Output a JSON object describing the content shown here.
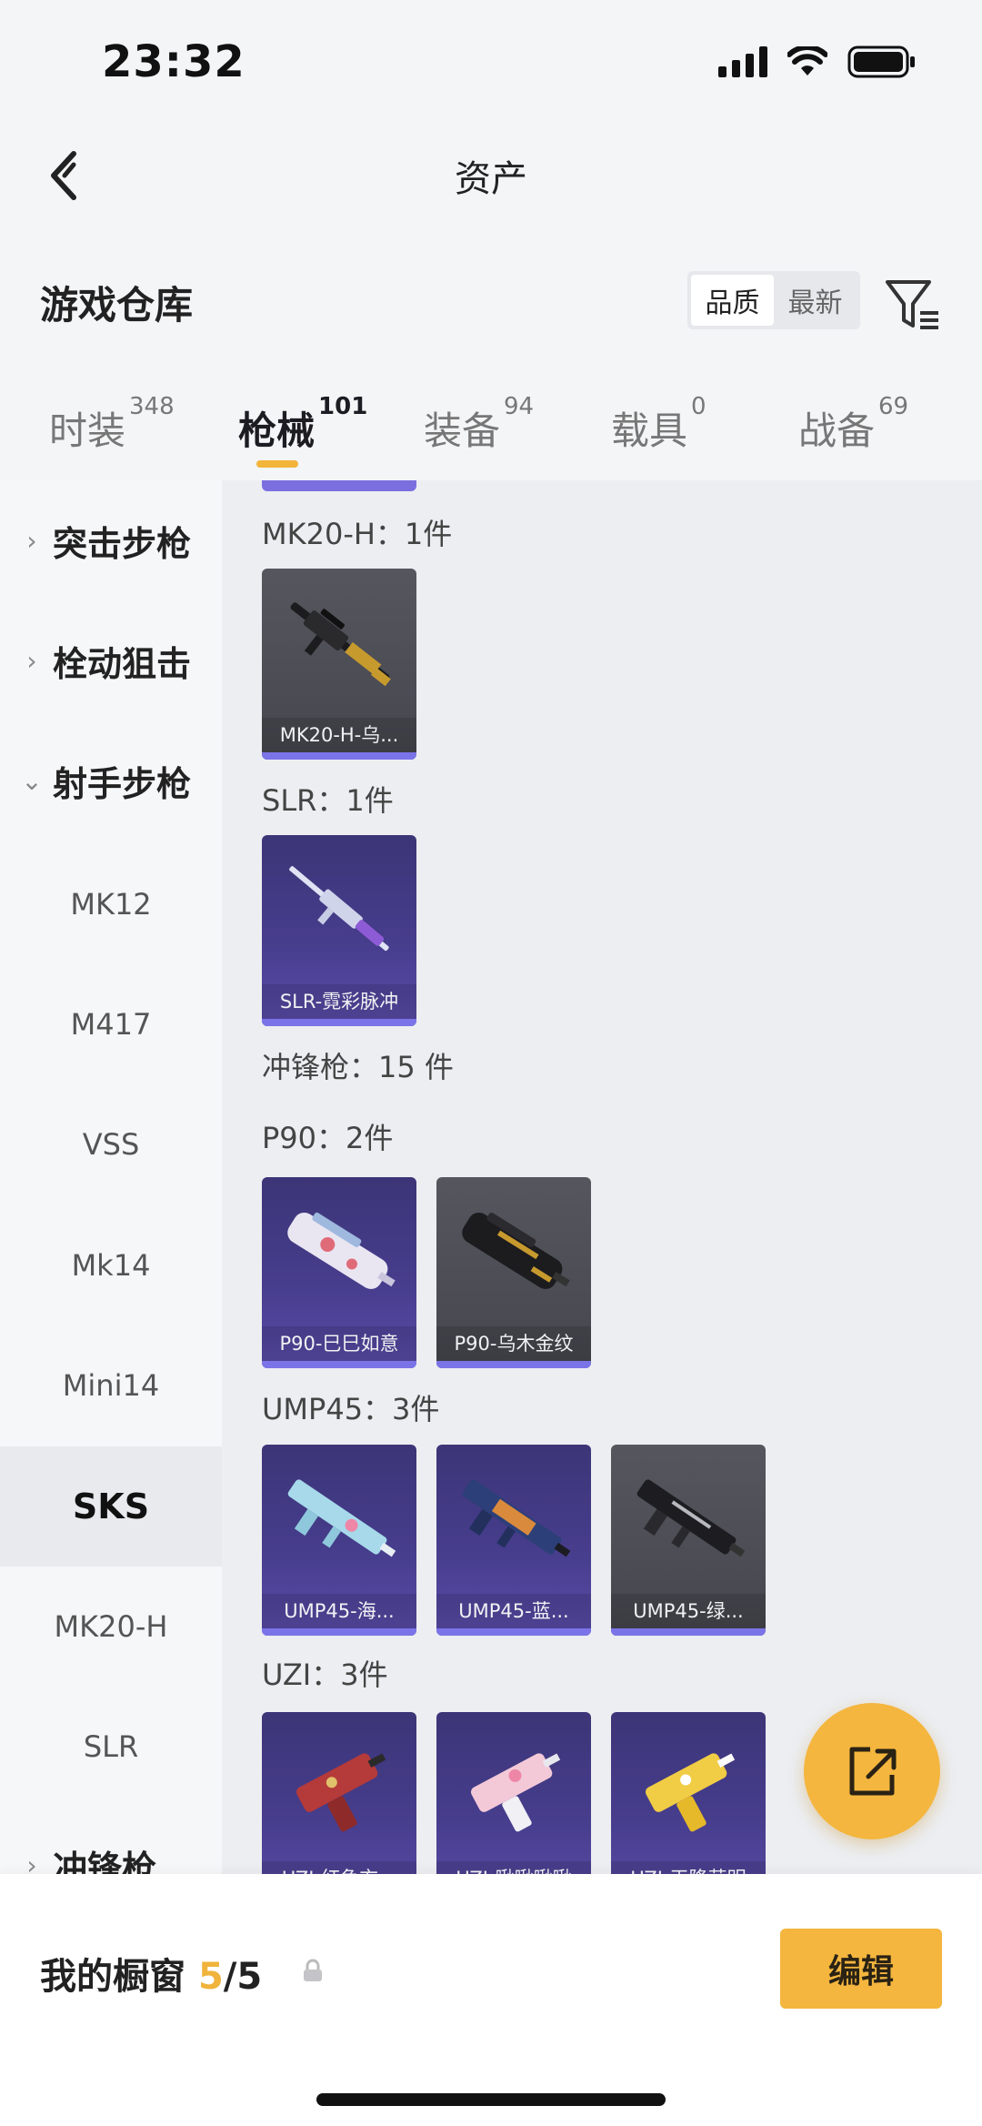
{
  "status": {
    "time": "23:32"
  },
  "nav": {
    "title": "资产"
  },
  "header": {
    "title": "游戏仓库",
    "sort_quality": "品质",
    "sort_latest": "最新"
  },
  "tabs": [
    {
      "label": "时装",
      "count": "348"
    },
    {
      "label": "枪械",
      "count": "101"
    },
    {
      "label": "装备",
      "count": "94"
    },
    {
      "label": "载具",
      "count": "0"
    },
    {
      "label": "战备",
      "count": "69"
    }
  ],
  "sidebar": {
    "items": [
      {
        "label": "突击步枪",
        "kind": "group-collapsed"
      },
      {
        "label": "栓动狙击",
        "kind": "group-collapsed"
      },
      {
        "label": "射手步枪",
        "kind": "group-expanded"
      },
      {
        "label": "MK12",
        "kind": "item"
      },
      {
        "label": "M417",
        "kind": "item"
      },
      {
        "label": "VSS",
        "kind": "item"
      },
      {
        "label": "Mk14",
        "kind": "item"
      },
      {
        "label": "Mini14",
        "kind": "item"
      },
      {
        "label": "SKS",
        "kind": "selected"
      },
      {
        "label": "MK20-H",
        "kind": "item"
      },
      {
        "label": "SLR",
        "kind": "item"
      },
      {
        "label": "冲锋枪",
        "kind": "group-collapsed"
      }
    ]
  },
  "content": {
    "sections": [
      {
        "label": "MK20-H：1件",
        "cards": [
          {
            "name": "MK20-H-乌...",
            "style": "gray"
          }
        ]
      },
      {
        "label": "SLR：1件",
        "cards": [
          {
            "name": "SLR-霓彩脉冲",
            "style": "purple"
          }
        ]
      },
      {
        "label": "冲锋枪：15 件",
        "cards": []
      },
      {
        "label": "P90：2件",
        "cards": [
          {
            "name": "P90-巳巳如意",
            "style": "purple"
          },
          {
            "name": "P90-乌木金纹",
            "style": "gray"
          }
        ]
      },
      {
        "label": "UMP45：3件",
        "cards": [
          {
            "name": "UMP45-海...",
            "style": "purple"
          },
          {
            "name": "UMP45-蓝...",
            "style": "purple"
          },
          {
            "name": "UMP45-绿...",
            "style": "gray"
          }
        ]
      },
      {
        "label": "UZI：3件",
        "cards": [
          {
            "name": "UZI-红龟玄...",
            "style": "purple"
          },
          {
            "name": "UZI-啾啾啾啾",
            "style": "purple"
          },
          {
            "name": "UZI-天降萌明",
            "style": "purple"
          }
        ]
      }
    ]
  },
  "bottom": {
    "showcase_label": "我的橱窗",
    "current": "5",
    "total": "/5",
    "edit_label": "编辑"
  },
  "colors": {
    "accent": "#f4b63e",
    "card_bar": "#7b74e8",
    "sidebar_bg": "#f6f7f9",
    "content_bg": "#eceef2"
  }
}
